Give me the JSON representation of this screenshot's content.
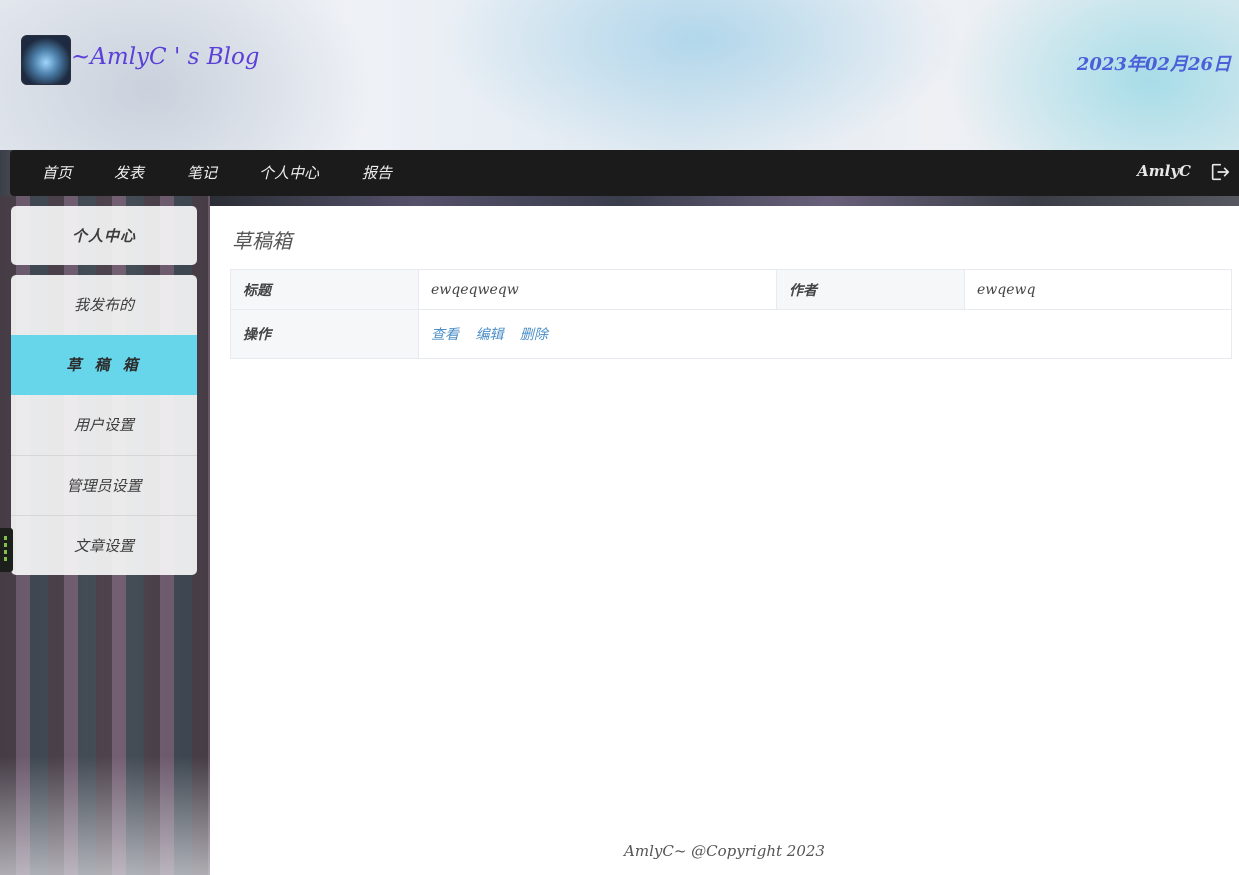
{
  "header": {
    "title": "~AmlyC ' s Blog",
    "date": "2023年02月26日"
  },
  "nav": {
    "items": [
      "首页",
      "发表",
      "笔记",
      "个人中心",
      "报告"
    ],
    "username": "AmlyC"
  },
  "sidebar": {
    "section_title": "个人中心",
    "items": [
      {
        "label": "我发布的",
        "active": false
      },
      {
        "label": "草 稿 箱",
        "active": true
      },
      {
        "label": "用户设置",
        "active": false
      },
      {
        "label": "管理员设置",
        "active": false
      },
      {
        "label": "文章设置",
        "active": false
      }
    ]
  },
  "main": {
    "title": "草稿箱",
    "table": {
      "title_label": "标题",
      "title_value": "ewqeqweqw",
      "author_label": "作者",
      "author_value": "ewqewq",
      "actions_label": "操作",
      "actions": [
        "查看",
        "编辑",
        "删除"
      ]
    },
    "footer": "AmlyC~ @Copyright 2023"
  },
  "colors": {
    "accent": "#67d5ea",
    "nav_bg": "#1b1b1c",
    "title": "#5a3fd8",
    "date": "#4a5fd8",
    "link": "#4a8ec8"
  },
  "icons": {
    "logout": "logout-icon",
    "logo": "blog-logo"
  }
}
